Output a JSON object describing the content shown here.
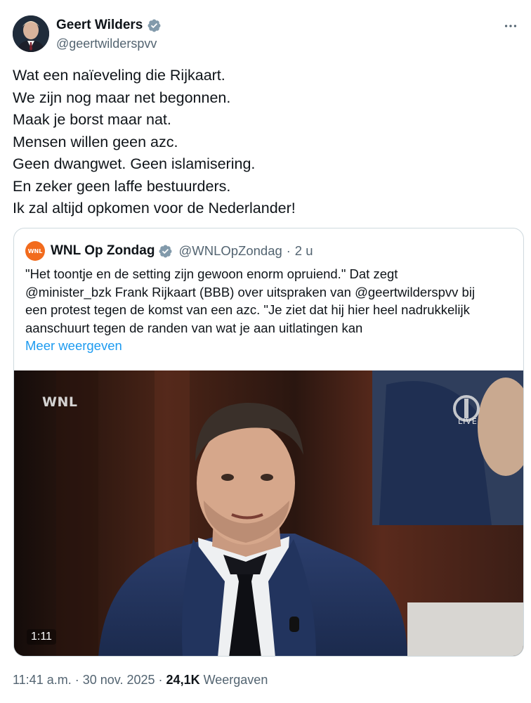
{
  "author": {
    "name": "Geert Wilders",
    "handle": "@geertwilderspvv",
    "verified_color": "#829aab"
  },
  "more_icon": "more-horizontal-icon",
  "tweet_lines": [
    "Wat een naïeveling die Rijkaart.",
    "We zijn nog maar net begonnen.",
    "Maak je borst maar nat.",
    "Mensen willen geen azc.",
    "Geen dwangwet. Geen islamisering.",
    "En zeker geen laffe bestuurders.",
    "Ik zal altijd opkomen voor de Nederlander!"
  ],
  "quote": {
    "logo_text": "WNL",
    "name": "WNL Op Zondag",
    "verified_color": "#829aab",
    "handle": "@WNLOpZondag",
    "separator": "·",
    "time": "2 u",
    "text_lines": [
      "\"Het toontje en de setting zijn gewoon enorm opruiend.\" Dat zegt",
      "@minister_bzk Frank Rijkaart (BBB) over uitspraken van @geertwilderspvv bij",
      "een protest tegen de komst van een azc. \"Je ziet dat hij hier heel nadrukkelijk",
      "aanschuurt tegen de randen van wat je aan uitlatingen kan"
    ],
    "show_more": "Meer weergeven",
    "video": {
      "watermark": "WNL",
      "live_label": "LIVE",
      "duration": "1:11"
    }
  },
  "meta": {
    "time": "11:41 a.m.",
    "sep1": "·",
    "date": "30 nov. 2025",
    "sep2": "·",
    "views_count": "24,1K",
    "views_label": "Weergaven"
  },
  "colors": {
    "text": "#0f1419",
    "secondary": "#536471",
    "link": "#1d9bf0",
    "border": "#cfd9de",
    "wnl_orange": "#f26b1d"
  }
}
